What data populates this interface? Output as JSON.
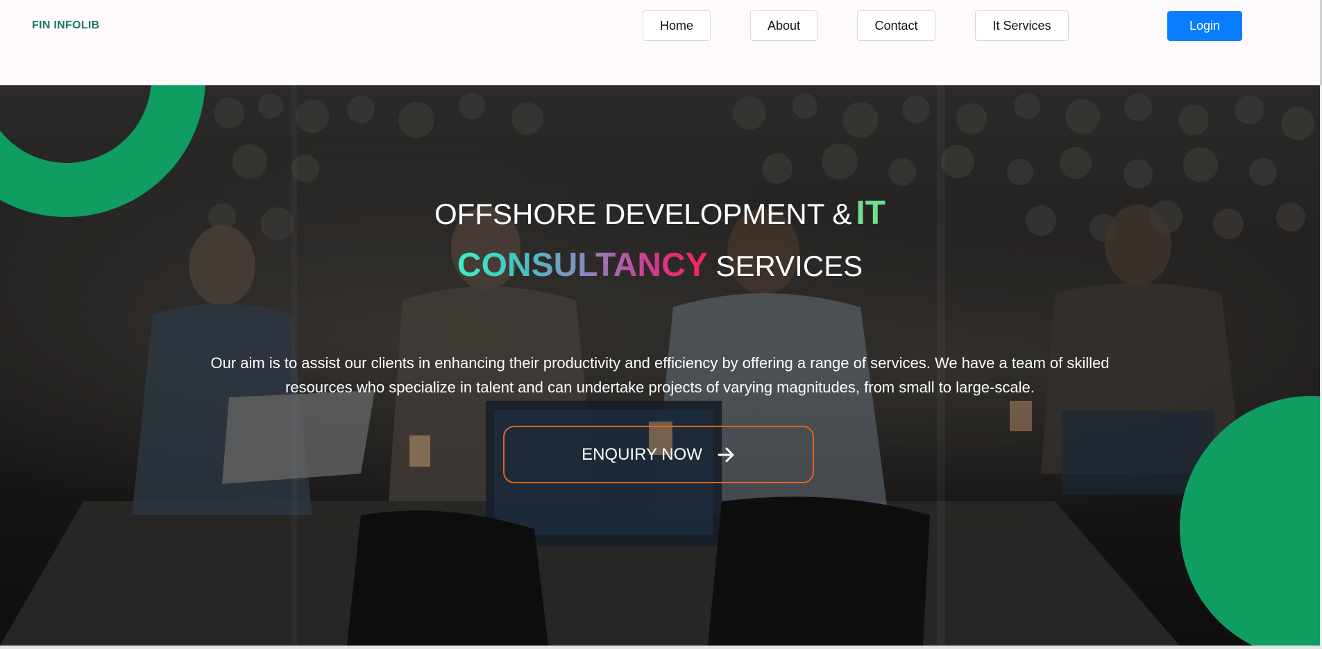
{
  "brand": {
    "name": "FIN INFOLIB"
  },
  "nav": {
    "items": [
      {
        "label": "Home"
      },
      {
        "label": "About"
      },
      {
        "label": "Contact"
      },
      {
        "label": "It Services"
      }
    ],
    "login_label": "Login"
  },
  "hero": {
    "headline_part1": "OFFSHORE DEVELOPMENT &",
    "headline_it": "IT",
    "headline_consultancy": "CONSULTANCY",
    "headline_services": "SERVICES",
    "description": "Our aim is to assist our clients in enhancing their productivity and efficiency by offering a range of services. We have a team of skilled resources who specialize in talent and can undertake projects of varying magnitudes, from small to large-scale.",
    "cta_label": "ENQUIRY NOW",
    "cta_icon": "arrow-right-icon"
  },
  "colors": {
    "brand_green": "#157a5e",
    "accent_green": "#0f9d62",
    "login_blue": "#0a7cff",
    "cta_border": "#e8631a",
    "it_green": "#6fe08c"
  }
}
